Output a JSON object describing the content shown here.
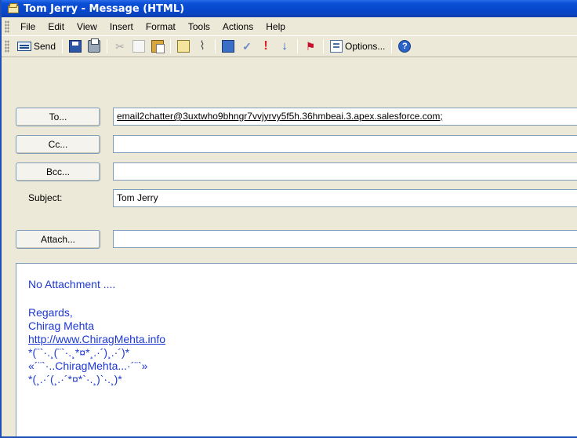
{
  "window": {
    "title": "Tom Jerry - Message (HTML)"
  },
  "menu": {
    "items": [
      "File",
      "Edit",
      "View",
      "Insert",
      "Format",
      "Tools",
      "Actions",
      "Help"
    ]
  },
  "toolbar": {
    "send_label": "Send",
    "options_label": "Options...",
    "icons": [
      "send-icon",
      "save-icon",
      "print-icon",
      "cut-icon",
      "copy-icon",
      "paste-icon",
      "signature-icon",
      "attach-icon",
      "address-book-icon",
      "check-names-icon",
      "high-importance-icon",
      "low-importance-icon",
      "follow-up-flag-icon",
      "options-icon",
      "help-icon"
    ]
  },
  "header": {
    "to_button": "To...",
    "cc_button": "Cc...",
    "bcc_button": "Bcc...",
    "subject_label": "Subject:",
    "attach_button": "Attach...",
    "to_value": "email2chatter@3uxtwho9bhngr7vvjyrvy5f5h.36hmbeai.3.apex.salesforce.com;",
    "cc_value": "",
    "bcc_value": "",
    "subject_value": "Tom Jerry",
    "attach_value": ""
  },
  "body": {
    "line1": "No Attachment ....",
    "line2": "Regards,",
    "line3": "Chirag Mehta",
    "line4": "http://www.ChiragMehta.info",
    "line5": "*(¨`·.¸(¨`·.¸*¤*¸.·´)¸.·´)*",
    "line6": "«´¨`·..ChiragMehta...·´¨`»",
    "line7": "*(¸.·´(¸.·´*¤*`·.¸)`·.¸)*"
  },
  "colors": {
    "titlebar": "#0a4fd6",
    "chrome": "#ece9d8",
    "body_text": "#1c37d6"
  }
}
